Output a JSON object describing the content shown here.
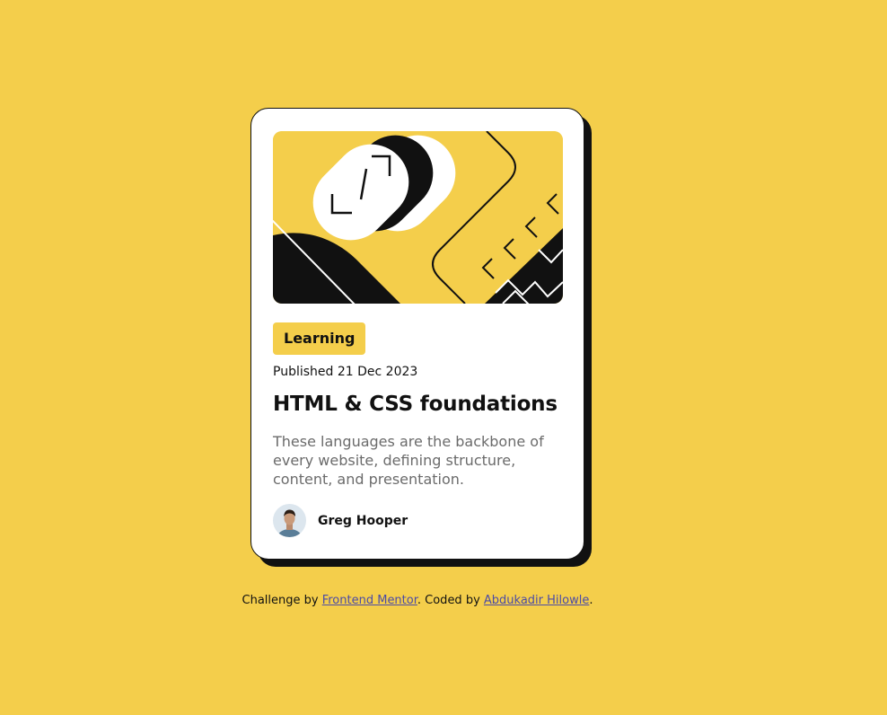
{
  "card": {
    "tag": "Learning",
    "published": "Published 21 Dec 2023",
    "title": "HTML & CSS foundations",
    "description": "These languages are the backbone of every website, defining structure, content, and presentation.",
    "author": {
      "name": "Greg Hooper"
    }
  },
  "attribution": {
    "prefix": "Challenge by ",
    "link1": "Frontend Mentor",
    "middle": ". Coded by ",
    "link2": "Abdukadir Hilowle",
    "suffix": "."
  },
  "colors": {
    "background": "#F4CE4B",
    "card": "#FFFFFF",
    "text": "#111111",
    "muted": "#6B6B6B",
    "link": "#4B4BA6"
  },
  "icons": {
    "hero": "abstract-illustration",
    "avatar": "user-avatar"
  }
}
